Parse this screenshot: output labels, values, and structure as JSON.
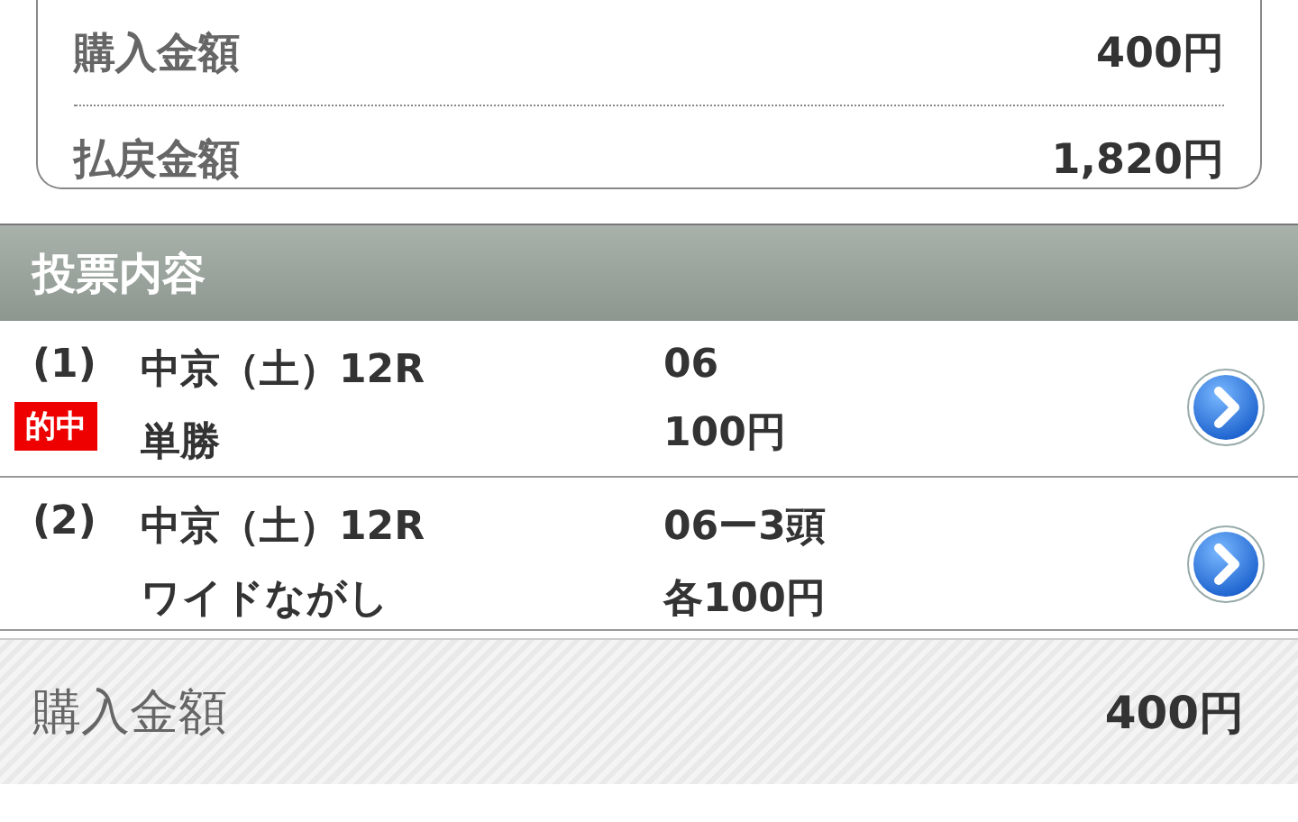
{
  "summary": [
    {
      "label": "購入金額",
      "value": "400円"
    },
    {
      "label": "払戻金額",
      "value": "1,820円"
    }
  ],
  "section": {
    "title": "投票内容"
  },
  "bets": [
    {
      "number": "(1)",
      "badge": "的中",
      "race": "中京（土）12R",
      "type": "単勝",
      "selection": "06",
      "amount": "100円"
    },
    {
      "number": "(2)",
      "race": "中京（土）12R",
      "type": "ワイドながし",
      "selection": "06ー3頭",
      "amount": "各100円"
    }
  ],
  "footer": {
    "label": "購入金額",
    "value": "400円"
  }
}
